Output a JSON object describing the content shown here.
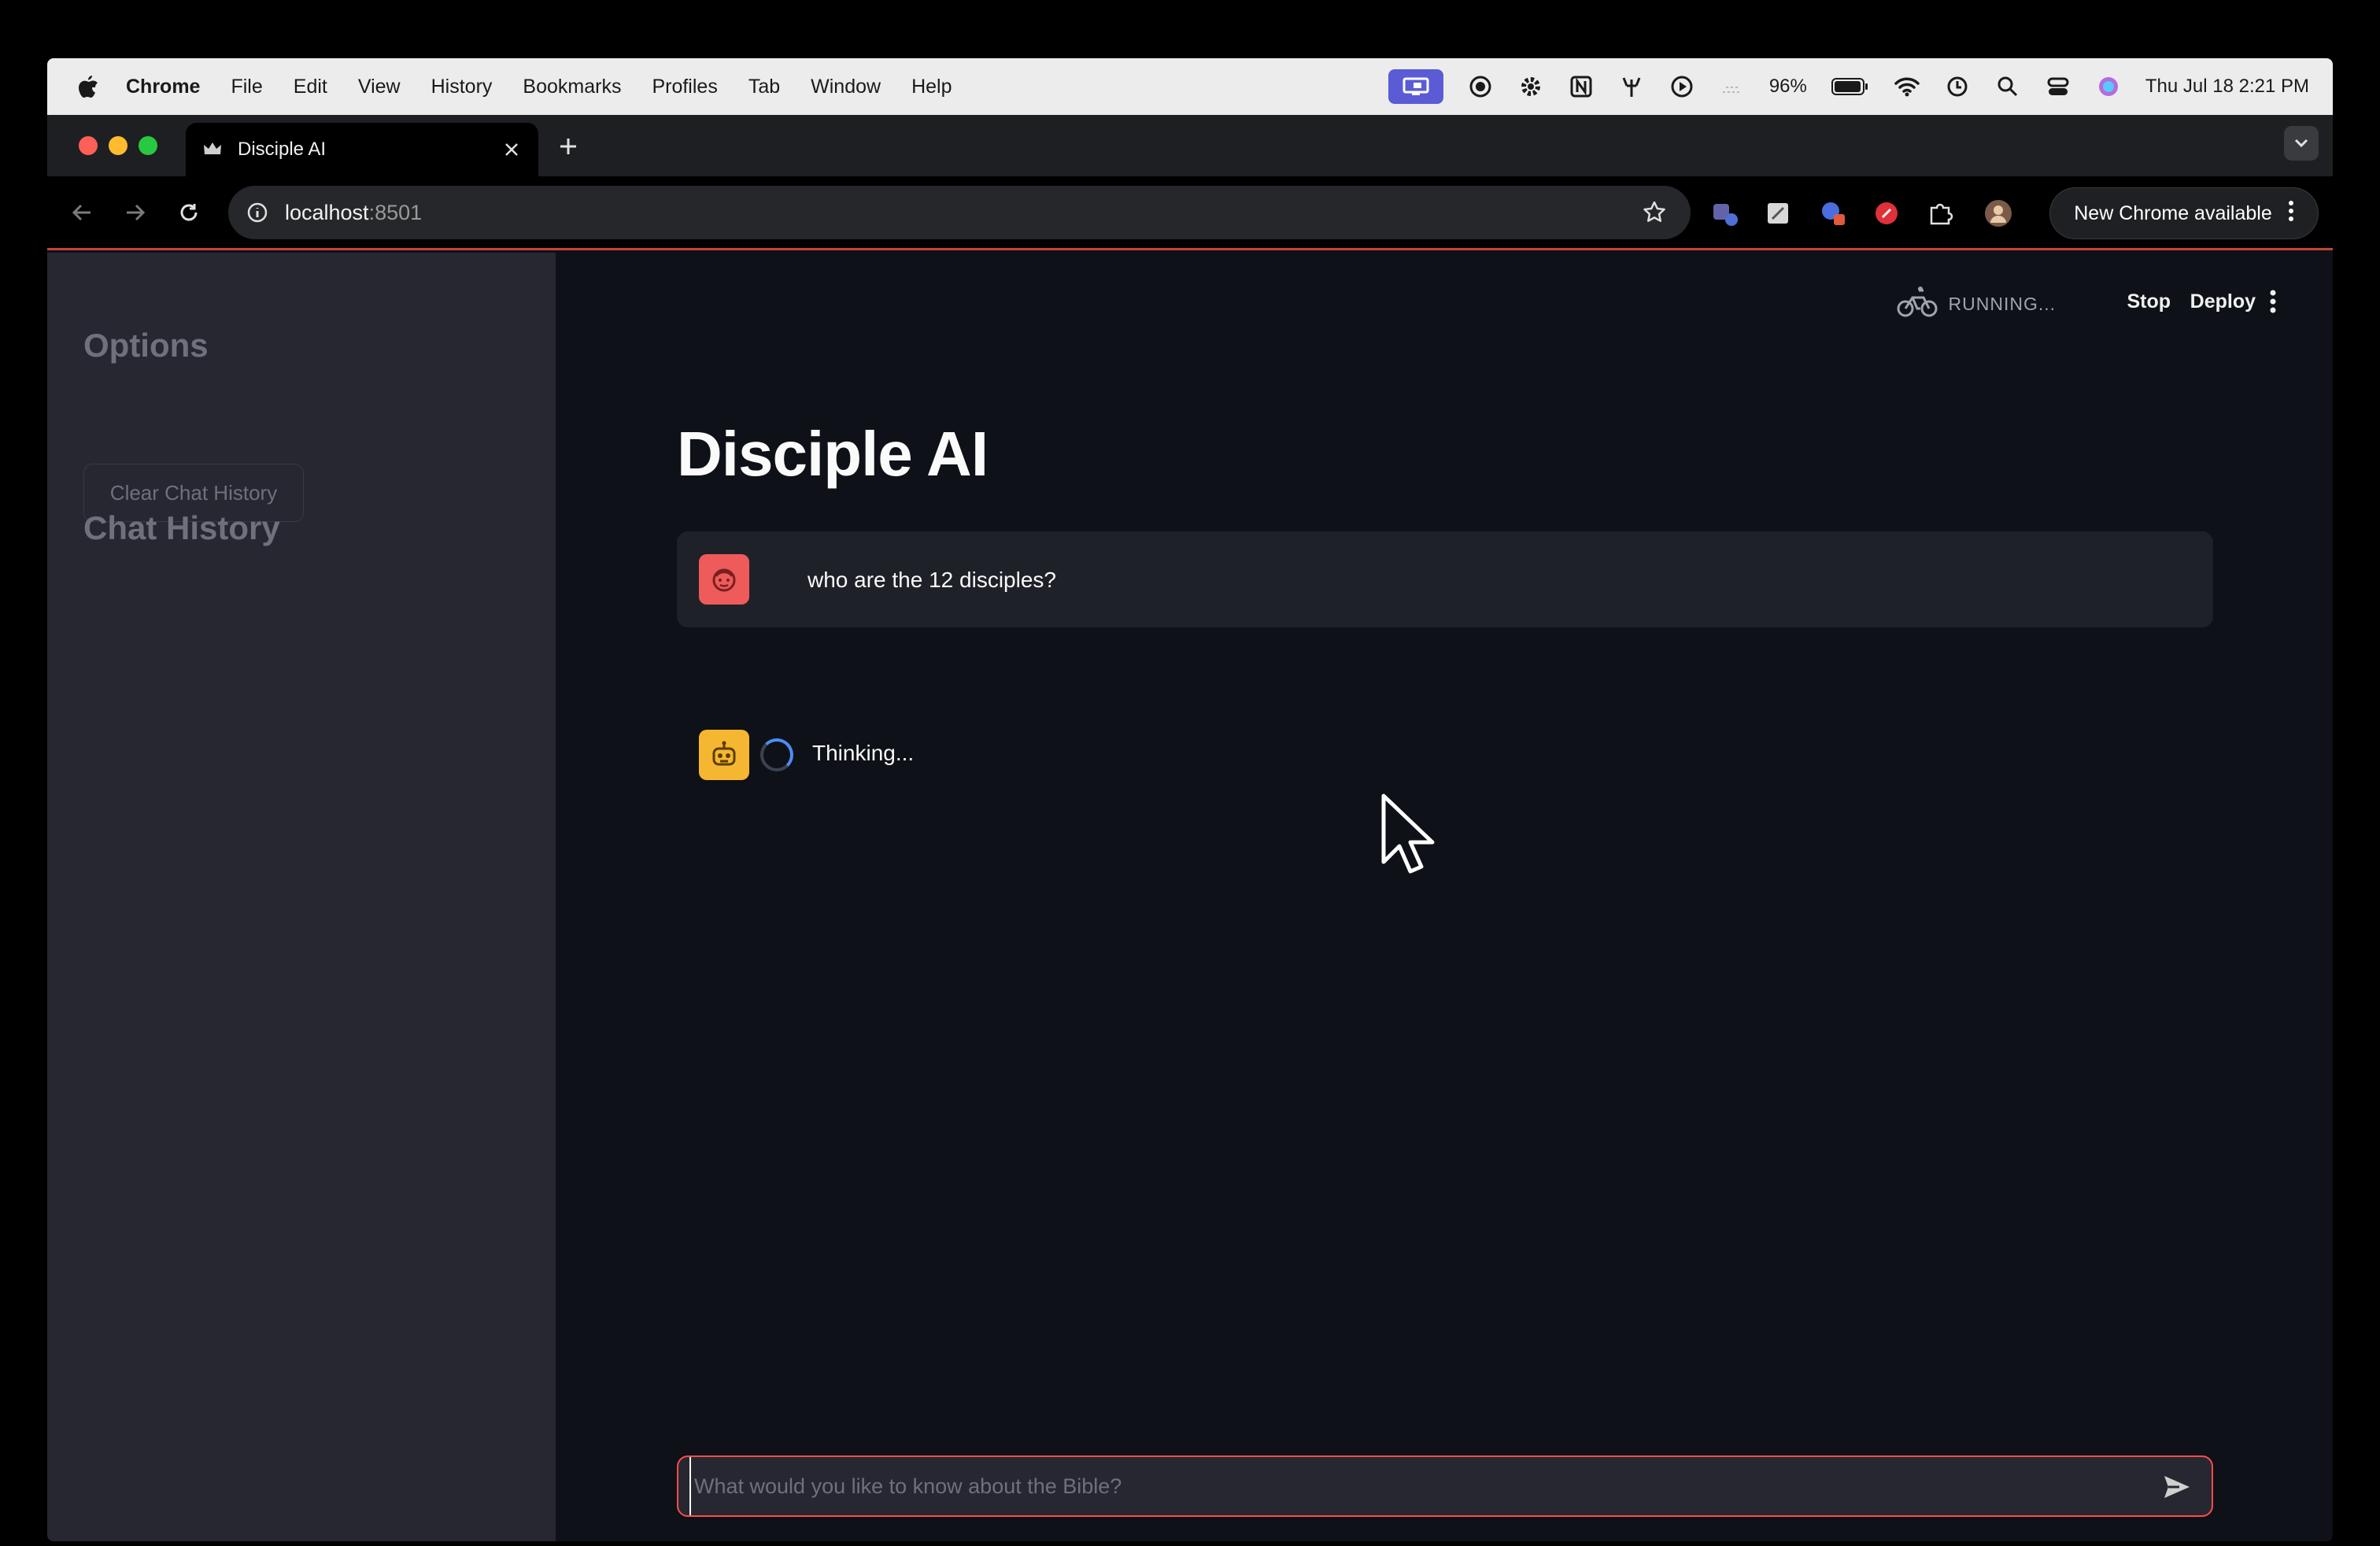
{
  "menubar": {
    "app_name": "Chrome",
    "items": [
      "File",
      "Edit",
      "View",
      "History",
      "Bookmarks",
      "Profiles",
      "Tab",
      "Window",
      "Help"
    ],
    "battery": "96%",
    "datetime": "Thu Jul 18  2:21 PM"
  },
  "browser": {
    "tab_title": "Disciple AI",
    "url_host": "localhost",
    "url_port": ":8501",
    "update_label": "New Chrome available"
  },
  "app_header": {
    "status": "RUNNING...",
    "stop_label": "Stop",
    "deploy_label": "Deploy"
  },
  "sidebar": {
    "options_heading": "Options",
    "clear_button": "Clear Chat History",
    "history_heading": "Chat History"
  },
  "main": {
    "title": "Disciple AI",
    "user_message": "who are the 12 disciples?",
    "assistant_status": "Thinking...",
    "input_placeholder": "What would you like to know about the Bible?"
  },
  "colors": {
    "accent": "#ff4b4b",
    "sidebar_bg": "#262730",
    "main_bg": "#0e1117",
    "user_avatar": "#ef5b5b",
    "assistant_avatar": "#f5b731",
    "spinner": "#4c8df6"
  },
  "icons": {
    "user_avatar": "face-icon",
    "assistant_avatar": "robot-icon",
    "send": "send-arrow-icon",
    "running": "bicycle-icon"
  }
}
